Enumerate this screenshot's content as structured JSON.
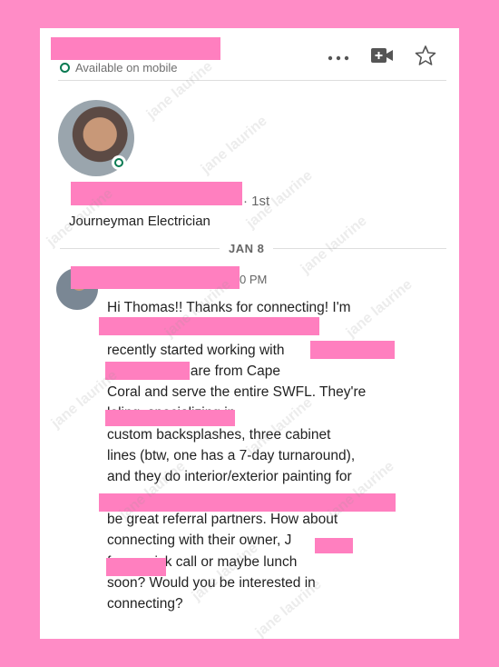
{
  "header": {
    "status_text": "Available on mobile",
    "more_icon": "more-horizontal-icon",
    "video_icon": "video-call-icon",
    "star_icon": "star-icon"
  },
  "profile": {
    "degree": "· 1st",
    "headline": "Journeyman Electrician"
  },
  "thread": {
    "date": "JAN 8",
    "time": "0 PM",
    "message": "Hi Thomas!! Thanks for connecting! I'm\n. We've\nrecently started working with\nlutions. They are from Cape\nCoral and serve the entire SWFL. They're\nleling, specializing in\ncustom backsplashes, three cabinet\nlines (btw, one has a 7-day turnaround),\nand they do interior/exterior painting for\n\nbe great referral partners. How about\nconnecting with their owner, J\nfor a quick call or maybe lunch\nsoon? Would you be interested in\nconnecting?"
  },
  "watermark": "jane laurine"
}
